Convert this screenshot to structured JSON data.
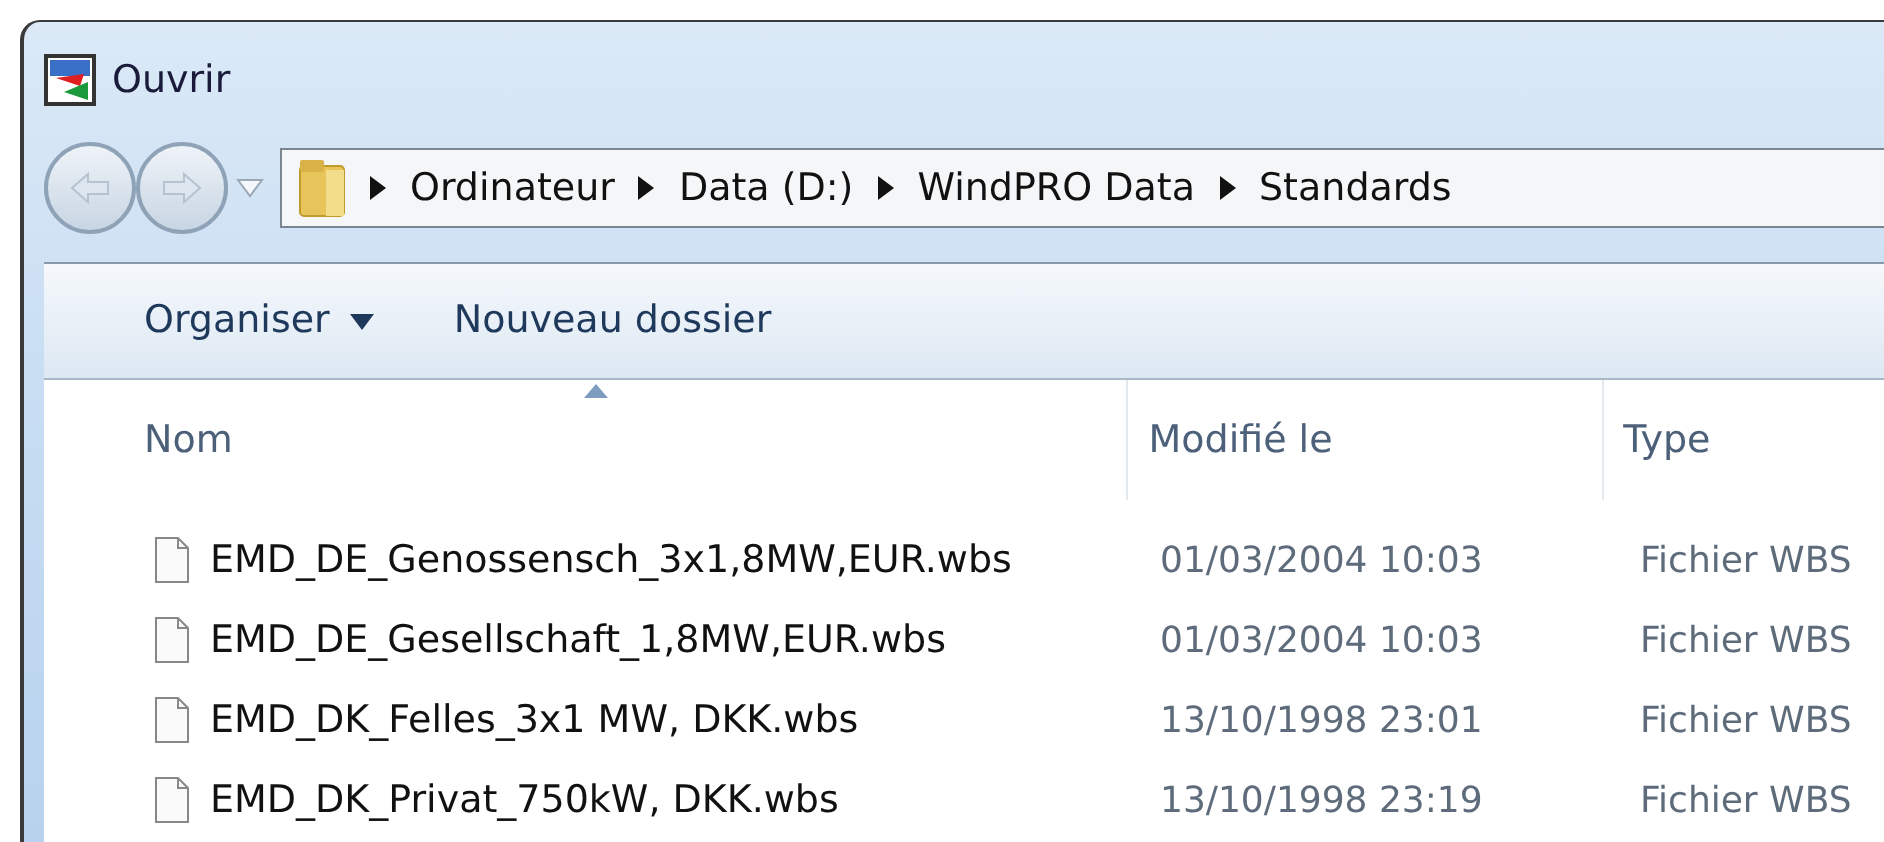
{
  "window": {
    "title": "Ouvrir"
  },
  "breadcrumb": [
    "Ordinateur",
    "Data (D:)",
    "WindPRO Data",
    "Standards"
  ],
  "toolbar": [
    {
      "label": "Organiser",
      "kind": "menu"
    },
    {
      "label": "Nouveau dossier",
      "kind": "plain"
    }
  ],
  "table": {
    "columns": [
      {
        "label": "Nom",
        "sorted": true
      },
      {
        "label": "Modifié le",
        "sorted": false
      },
      {
        "label": "Type",
        "sorted": false
      }
    ],
    "rows": [
      {
        "name": "EMD_DE_Genossensch_3x1,8MW,EUR.wbs",
        "modified": "01/03/2004 10:03",
        "type": "Fichier WBS"
      },
      {
        "name": "EMD_DE_Gesellschaft_1,8MW,EUR.wbs",
        "modified": "01/03/2004 10:03",
        "type": "Fichier WBS"
      },
      {
        "name": "EMD_DK_Felles_3x1 MW, DKK.wbs",
        "modified": "13/10/1998 23:01",
        "type": "Fichier WBS"
      },
      {
        "name": "EMD_DK_Privat_750kW, DKK.wbs",
        "modified": "13/10/1998 23:19",
        "type": "Fichier WBS"
      }
    ]
  }
}
